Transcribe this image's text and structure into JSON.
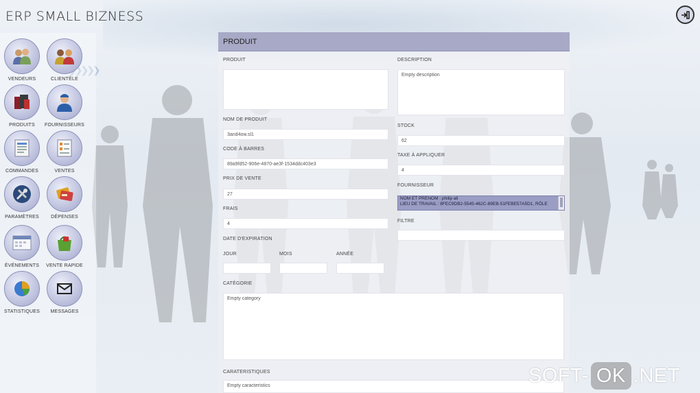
{
  "app": {
    "title": "ERP SMALL BIZNESS"
  },
  "exit_icon": "exit-icon",
  "nav": [
    {
      "key": "vendeurs",
      "label": "VENDEURS",
      "icon": "people-icon"
    },
    {
      "key": "clientele",
      "label": "CLIENTÈLE",
      "icon": "customers-icon"
    },
    {
      "key": "produits",
      "label": "PRODUITS",
      "icon": "products-icon"
    },
    {
      "key": "fournisseurs",
      "label": "FOURNISSEURS",
      "icon": "supplier-icon"
    },
    {
      "key": "commandes",
      "label": "COMMANDES",
      "icon": "orders-icon"
    },
    {
      "key": "ventes",
      "label": "VENTES",
      "icon": "sales-icon"
    },
    {
      "key": "parametres",
      "label": "PARAMÈTRES",
      "icon": "settings-icon"
    },
    {
      "key": "depenses",
      "label": "DÉPENSES",
      "icon": "expenses-icon"
    },
    {
      "key": "evenements",
      "label": "ÉVÉNEMENTS",
      "icon": "calendar-icon"
    },
    {
      "key": "vente_rapide",
      "label": "VENTE RAPIDE",
      "icon": "quick-sale-icon"
    },
    {
      "key": "statistiques",
      "label": "STATISTIQUES",
      "icon": "pie-chart-icon"
    },
    {
      "key": "messages",
      "label": "MESSAGES",
      "icon": "mail-icon"
    }
  ],
  "form": {
    "title": "PRODUIT",
    "produit": {
      "label": "PRODUIT",
      "value": ""
    },
    "description": {
      "label": "DESCRIPTION",
      "value": "Empty description"
    },
    "nom_de_produit": {
      "label": "NOM DE PRODUIT",
      "value": "3and4ow.sl1"
    },
    "stock": {
      "label": "STOCK",
      "value": "62"
    },
    "code_a_barres": {
      "label": "CODE À BARRES",
      "value": "89a9fd52-906e-4870-ae3f-1534ddc403e3"
    },
    "taxe": {
      "label": "TAXE À APPLIQUER",
      "value": "4"
    },
    "prix_de_vente": {
      "label": "PRIX DE VENTE",
      "value": "27"
    },
    "fournisseur": {
      "label": "FOURNISSEUR",
      "lines": [
        "NOM ET PRÉNOM : philip ali",
        "LIEU DE TRAVAIL : 8FEC9DB2-5545-462C-89EB-51FEBE57A5D1, RÔLE"
      ]
    },
    "frais": {
      "label": "FRAIS",
      "value": "4"
    },
    "filtre": {
      "label": "FILTRE",
      "value": ""
    },
    "date_expiration": {
      "label": "DATE D'EXPIRATION",
      "jour": {
        "label": "JOUR",
        "value": ""
      },
      "mois": {
        "label": "MOIS",
        "value": ""
      },
      "annee": {
        "label": "ANNÉE",
        "value": ""
      }
    },
    "categorie": {
      "label": "CATÉGORIE",
      "value": "Empty category"
    },
    "caracteristiques": {
      "label": "CARATERISTIQUES",
      "value": "Empty caracteristics"
    }
  },
  "watermark": {
    "left": "SOFT-",
    "ok": "OK",
    "right": ".NET"
  }
}
